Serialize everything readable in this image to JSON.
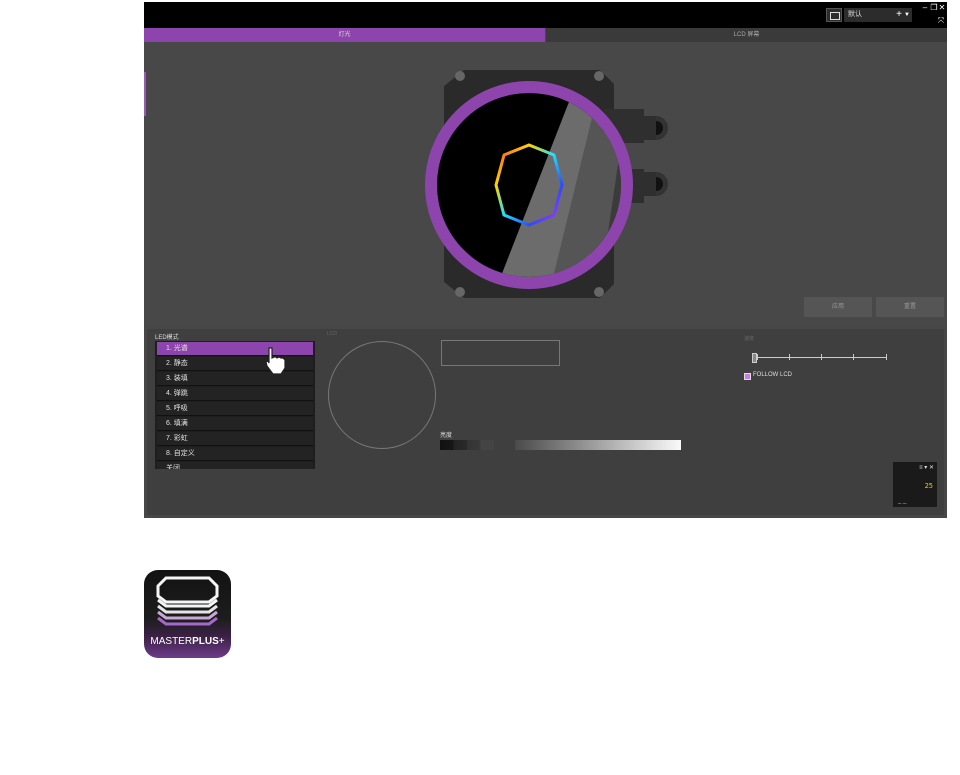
{
  "app": {
    "profile": {
      "selected": "默认",
      "add_icon": "plus-icon",
      "dropdown_icon": "chevron-down-icon"
    },
    "window_controls": {
      "minimize": "–",
      "restore": "❐",
      "close": "✕",
      "expand": "⤧"
    },
    "tabs": [
      {
        "label": "灯光",
        "active": true
      },
      {
        "label": "LCD 屏幕",
        "active": false
      }
    ],
    "viewport_buttons": {
      "apply": "应用",
      "reset": "重置"
    },
    "led_section": {
      "label": "LED模式",
      "modes": [
        {
          "label": "1. 光谱",
          "active": true
        },
        {
          "label": "2. 静态",
          "active": false
        },
        {
          "label": "3. 装填",
          "active": false
        },
        {
          "label": "4. 弹跳",
          "active": false
        },
        {
          "label": "5. 呼吸",
          "active": false
        },
        {
          "label": "6. 填满",
          "active": false
        },
        {
          "label": "7. 彩虹",
          "active": false
        },
        {
          "label": "8. 自定义",
          "active": false
        },
        {
          "label": "关闭",
          "active": false
        }
      ]
    },
    "lcd_label": "LCD",
    "brightness_label": "亮度",
    "speed_label": "速度",
    "follow_lcd": {
      "label": "FOLLOW LCD",
      "checked": true
    },
    "mini_widget": {
      "value": "25",
      "icons": "≡ ▾ ✕"
    },
    "accent_color": "#8e44ad"
  },
  "logo": {
    "brand_light": "MASTER",
    "brand_bold": "PLUS",
    "brand_suffix": "+"
  }
}
